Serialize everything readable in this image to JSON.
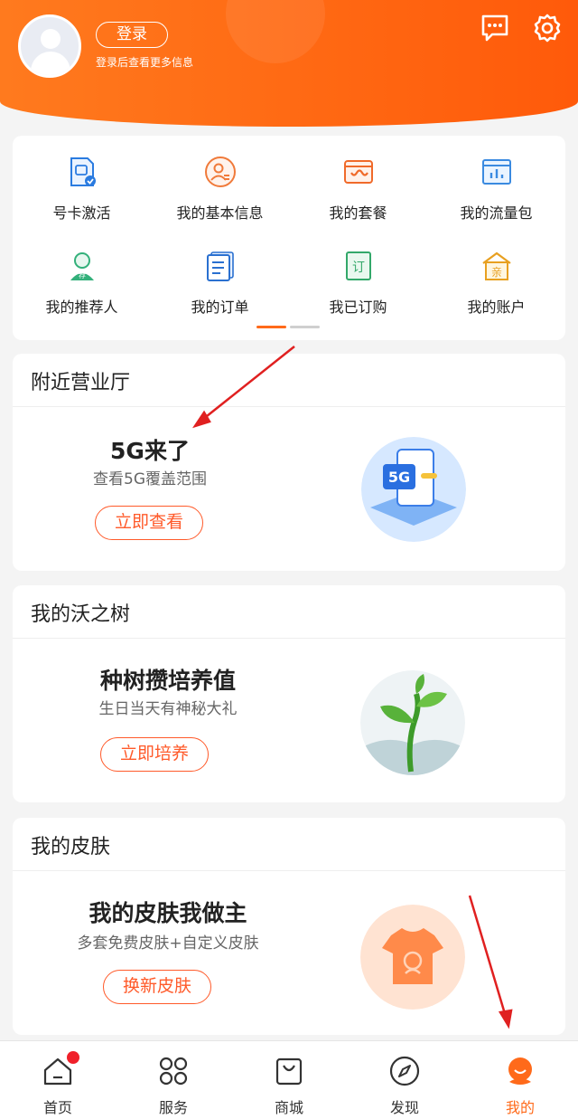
{
  "header": {
    "login_label": "登录",
    "login_hint": "登录后查看更多信息",
    "message_icon": "message-icon",
    "settings_icon": "gear-icon"
  },
  "quick_menu": {
    "items": [
      {
        "label": "号卡激活",
        "icon": "sim-card-icon"
      },
      {
        "label": "我的基本信息",
        "icon": "profile-icon"
      },
      {
        "label": "我的套餐",
        "icon": "package-icon"
      },
      {
        "label": "我的流量包",
        "icon": "data-package-icon"
      },
      {
        "label": "我的推荐人",
        "icon": "referrer-icon"
      },
      {
        "label": "我的订单",
        "icon": "order-icon"
      },
      {
        "label": "我已订购",
        "icon": "subscribed-icon"
      },
      {
        "label": "我的账户",
        "icon": "account-icon"
      }
    ],
    "page_count": 2,
    "current_page": 1
  },
  "sections": {
    "nearby": {
      "title": "附近营业厅",
      "headline": "5G来了",
      "sub": "查看5G覆盖范围",
      "button": "立即查看",
      "illus_text": "5G"
    },
    "tree": {
      "title": "我的沃之树",
      "headline": "种树攒培养值",
      "sub": "生日当天有神秘大礼",
      "button": "立即培养"
    },
    "skin": {
      "title": "我的皮肤",
      "headline": "我的皮肤我做主",
      "sub": "多套免费皮肤+自定义皮肤",
      "button": "换新皮肤"
    }
  },
  "tabbar": {
    "items": [
      {
        "label": "首页",
        "icon": "home-icon",
        "active": false,
        "badge": true
      },
      {
        "label": "服务",
        "icon": "services-icon",
        "active": false,
        "badge": false
      },
      {
        "label": "商城",
        "icon": "shop-bag-icon",
        "active": false,
        "badge": false
      },
      {
        "label": "发现",
        "icon": "compass-icon",
        "active": false,
        "badge": false
      },
      {
        "label": "我的",
        "icon": "mine-icon",
        "active": true,
        "badge": false
      }
    ]
  },
  "colors": {
    "brand": "#ff6a1a",
    "accent_red": "#ff5a2a",
    "badge": "#f0202a"
  }
}
